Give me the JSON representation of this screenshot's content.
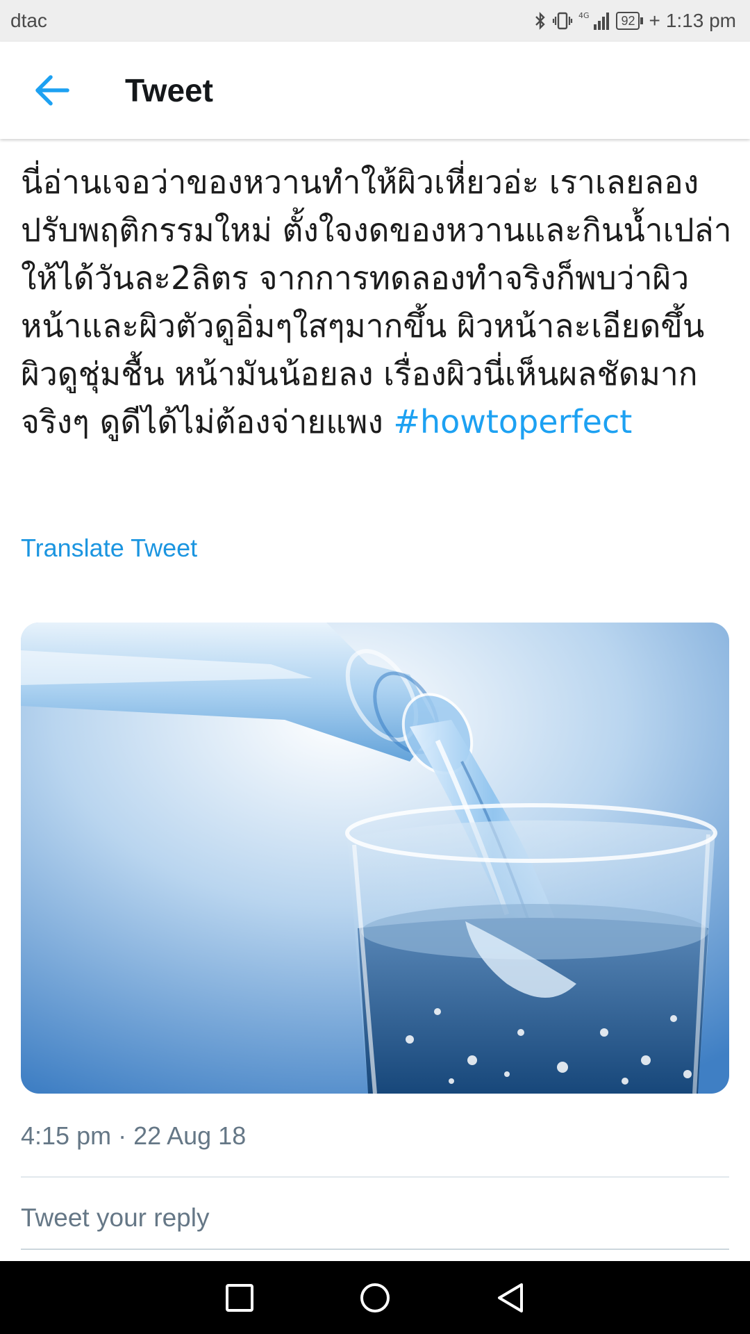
{
  "status_bar": {
    "carrier": "dtac",
    "network": "4G",
    "battery": "92",
    "time": "1:13 pm",
    "icons": [
      "bluetooth-icon",
      "vibrate-icon",
      "signal-icon",
      "battery-icon"
    ]
  },
  "header": {
    "title": "Tweet",
    "back_icon": "arrow-left-icon",
    "accent_color": "#1da1f2"
  },
  "tweet": {
    "text": "นี่อ่านเจอว่าของหวานทำให้ผิวเหี่ยวอ่ะ เราเลยลองปรับพฤติกรรมใหม่ ตั้งใจงดของหวานและกินน้ำเปล่าให้ได้วันละ2ลิตร จากการทดลองทำจริงก็พบว่าผิวหน้าและผิวตัวดูอิ่มๆใสๆมากขึ้น ผิวหน้าละเอียดขึ้น ผิวดูชุ่มชื้น หน้ามันน้อยลง เรื่องผิวนี่เห็นผลชัดมากจริงๆ ดูดีได้ไม่ต้องจ่ายแพง ",
    "hashtag": "#howtoperfect",
    "translate_label": "Translate Tweet",
    "media": {
      "type": "image"
    },
    "timestamp": "4:15 pm · 22 Aug 18"
  },
  "reply": {
    "placeholder": "Tweet your reply"
  },
  "nav_bar": {
    "buttons": [
      "recents-square-icon",
      "home-circle-icon",
      "back-triangle-icon"
    ]
  }
}
